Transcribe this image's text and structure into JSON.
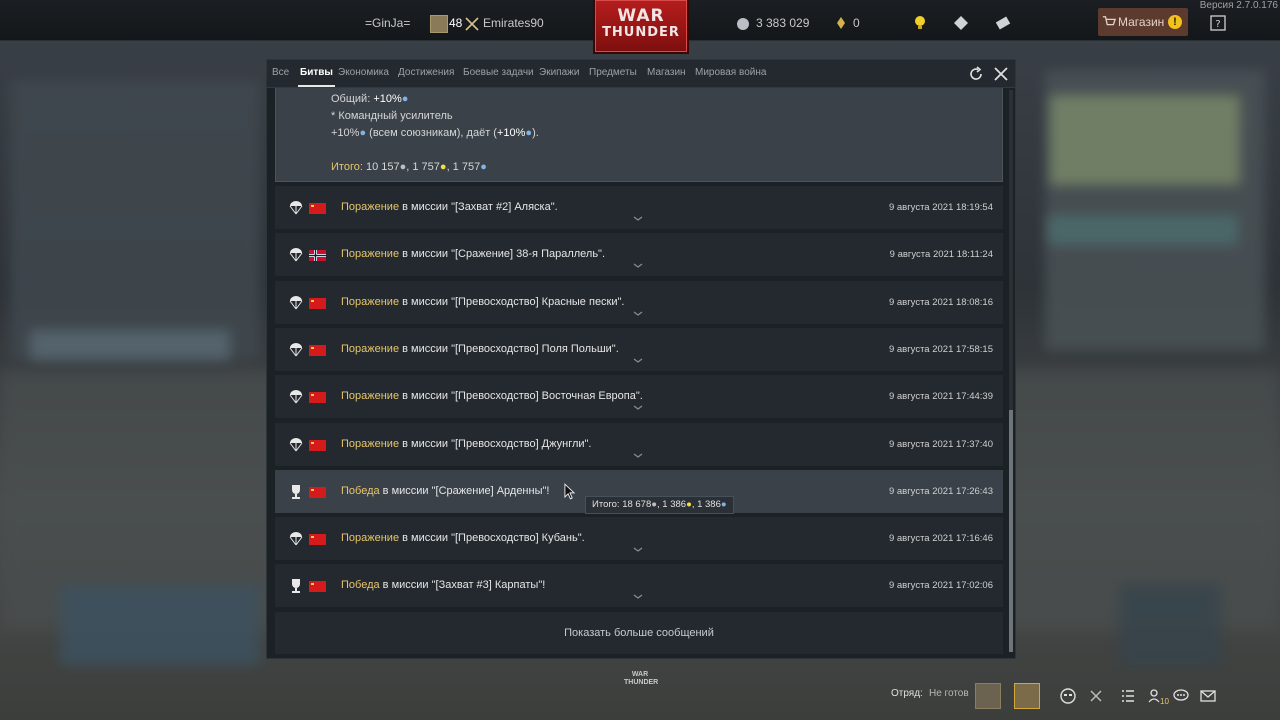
{
  "app": {
    "version": "Версия 2.7.0.176",
    "logo_line1": "WAR",
    "logo_line2": "THUNDER",
    "logo_small_line1": "WAR",
    "logo_small_line2": "THUNDER"
  },
  "topbar": {
    "clan_tag": "=GinJa=",
    "level": "48",
    "username": "Emirates90",
    "silver": "3 383 029",
    "golden_eagles": "0",
    "shop_label": "Магазин",
    "shop_alert": "!"
  },
  "tabs": [
    {
      "label": "Все",
      "active": false
    },
    {
      "label": "Битвы",
      "active": true
    },
    {
      "label": "Экономика",
      "active": false
    },
    {
      "label": "Достижения",
      "active": false
    },
    {
      "label": "Боевые задачи",
      "active": false
    },
    {
      "label": "Экипажи",
      "active": false
    },
    {
      "label": "Предметы",
      "active": false
    },
    {
      "label": "Магазин",
      "active": false
    },
    {
      "label": "Мировая война",
      "active": false
    }
  ],
  "summary": {
    "line1_label": "Общий:",
    "line1_value": "+10%",
    "line2": "* Командный усилитель",
    "line3_a": "+10%",
    "line3_b": " (всем союзникам), даёт (",
    "line3_c": "+10%",
    "line3_d": ").",
    "total_label": "Итого:",
    "total_value": "10 157",
    "total_rp": ", 1 757",
    "total_crp": ", 1 757"
  },
  "battles": [
    {
      "result": "Поражение",
      "win": false,
      "text": " в миссии \"[Захват #2] Аляска\".",
      "date": "9 августа 2021 18:19:54",
      "flag": "ussr"
    },
    {
      "result": "Поражение",
      "win": false,
      "text": " в миссии \"[Сражение] 38-я Параллель\".",
      "date": "9 августа 2021 18:11:24",
      "flag": "norway"
    },
    {
      "result": "Поражение",
      "win": false,
      "text": " в миссии \"[Превосходство] Красные пески\".",
      "date": "9 августа 2021 18:08:16",
      "flag": "ussr"
    },
    {
      "result": "Поражение",
      "win": false,
      "text": " в миссии \"[Превосходство] Поля Польши\".",
      "date": "9 августа 2021 17:58:15",
      "flag": "ussr"
    },
    {
      "result": "Поражение",
      "win": false,
      "text": " в миссии \"[Превосходство] Восточная Европа\".",
      "date": "9 августа 2021 17:44:39",
      "flag": "ussr"
    },
    {
      "result": "Поражение",
      "win": false,
      "text": " в миссии \"[Превосходство] Джунгли\".",
      "date": "9 августа 2021 17:37:40",
      "flag": "ussr"
    },
    {
      "result": "Победа",
      "win": true,
      "text": " в миссии \"[Сражение] Арденны\"!",
      "date": "9 августа 2021 17:26:43",
      "flag": "ussr",
      "highlighted": true
    },
    {
      "result": "Поражение",
      "win": false,
      "text": " в миссии \"[Превосходство] Кубань\".",
      "date": "9 августа 2021 17:16:46",
      "flag": "ussr"
    },
    {
      "result": "Победа",
      "win": true,
      "text": " в миссии \"[Захват #3] Карпаты\"!",
      "date": "9 августа 2021 17:02:06",
      "flag": "ussr"
    }
  ],
  "tooltip": {
    "label": "Итого:",
    "silver": "18 678",
    "rp": ", 1 386",
    "crp": ", 1 386"
  },
  "show_more": "Показать больше сообщений",
  "bottom": {
    "squad_label": "Отряд:",
    "status": "Не готов",
    "count": "10"
  },
  "colors": {
    "accent_gold": "#e8c56a",
    "logo_red": "#b51d1d",
    "panel_bg": "#1c2126",
    "row_bg": "#23292e",
    "row_highlight": "#3a4148"
  }
}
